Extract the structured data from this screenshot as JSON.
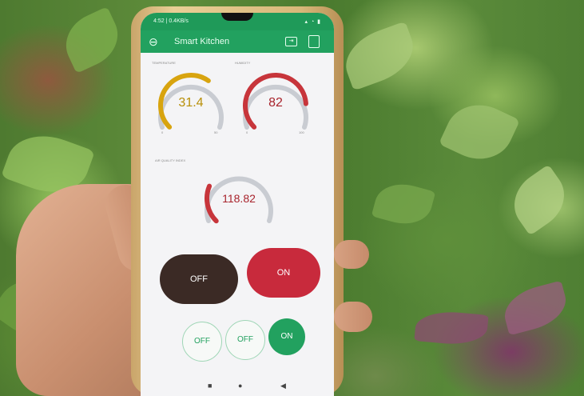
{
  "status_bar": {
    "time": "4:52 | 0.4KB/s",
    "icons": "▴ ◔ ▮"
  },
  "app": {
    "title": "Smart Kitchen",
    "back_icon": "back-arrow-icon",
    "share_icon": "share-icon",
    "menu_icon": "menu-icon"
  },
  "gauges": {
    "temperature": {
      "label": "TEMPERATURE",
      "value": "31.4",
      "min": "0",
      "max": "50",
      "fraction": 0.63,
      "color": "#d8a40f"
    },
    "humidity": {
      "label": "HUMIDITY",
      "value": "82",
      "min": "0",
      "max": "100",
      "fraction": 0.82,
      "color": "#c7353b"
    },
    "air_quality": {
      "label": "AIR QUALITY INDEX",
      "value": "118.82",
      "fraction": 0.25,
      "color": "#c7353b"
    }
  },
  "toggles": {
    "big_left": {
      "label": "OFF",
      "color": "#3b2a25"
    },
    "big_right": {
      "label": "ON",
      "color": "#c82a3c"
    },
    "small": [
      {
        "label": "OFF",
        "state": "off"
      },
      {
        "label": "OFF",
        "state": "off"
      },
      {
        "label": "ON",
        "state": "on",
        "color": "#22a15f"
      }
    ]
  },
  "nav": {
    "square": "■",
    "home": "●",
    "back": "◀"
  }
}
